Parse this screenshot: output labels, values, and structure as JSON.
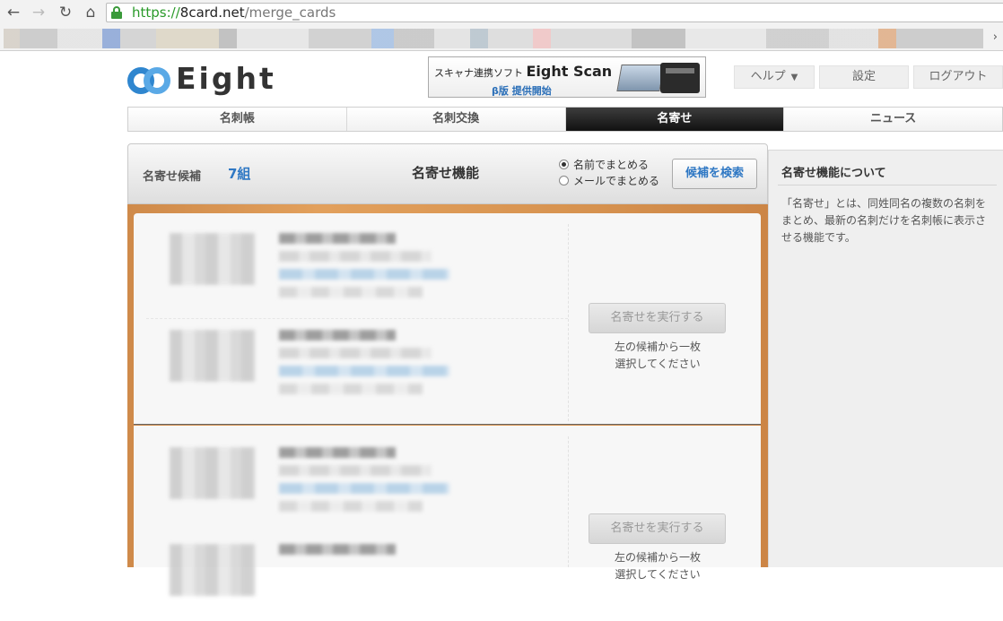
{
  "browser": {
    "url_scheme": "https://",
    "url_host": "8card.net",
    "url_path": "/merge_cards",
    "bookmarks_more": "›"
  },
  "header": {
    "logo_text": "Eight",
    "banner": {
      "line1_prefix": "スキャナ連携ソフト",
      "line1_product": "Eight Scan",
      "line2": "β版 提供開始"
    },
    "help": "ヘルプ",
    "help_caret": "▼",
    "settings": "設定",
    "logout": "ログアウト"
  },
  "tabs": [
    {
      "label": "名刺帳"
    },
    {
      "label": "名刺交換"
    },
    {
      "label": "名寄せ"
    },
    {
      "label": "ニュース"
    }
  ],
  "main": {
    "candidates_label": "名寄せ候補",
    "candidates_count": "7組",
    "title": "名寄せ機能",
    "radio_name": "名前でまとめる",
    "radio_email": "メールでまとめる",
    "search_button": "候補を検索",
    "groups": [
      {
        "merge_button": "名寄せを実行する",
        "hint_line1": "左の候補から一枚",
        "hint_line2": "選択してください"
      },
      {
        "merge_button": "名寄せを実行する",
        "hint_line1": "左の候補から一枚",
        "hint_line2": "選択してください"
      }
    ]
  },
  "sidebar": {
    "title": "名寄せ機能について",
    "body": "「名寄せ」とは、同姓同名の複数の名刺をまとめ、最新の名刺だけを名刺帳に表示させる機能です。"
  }
}
